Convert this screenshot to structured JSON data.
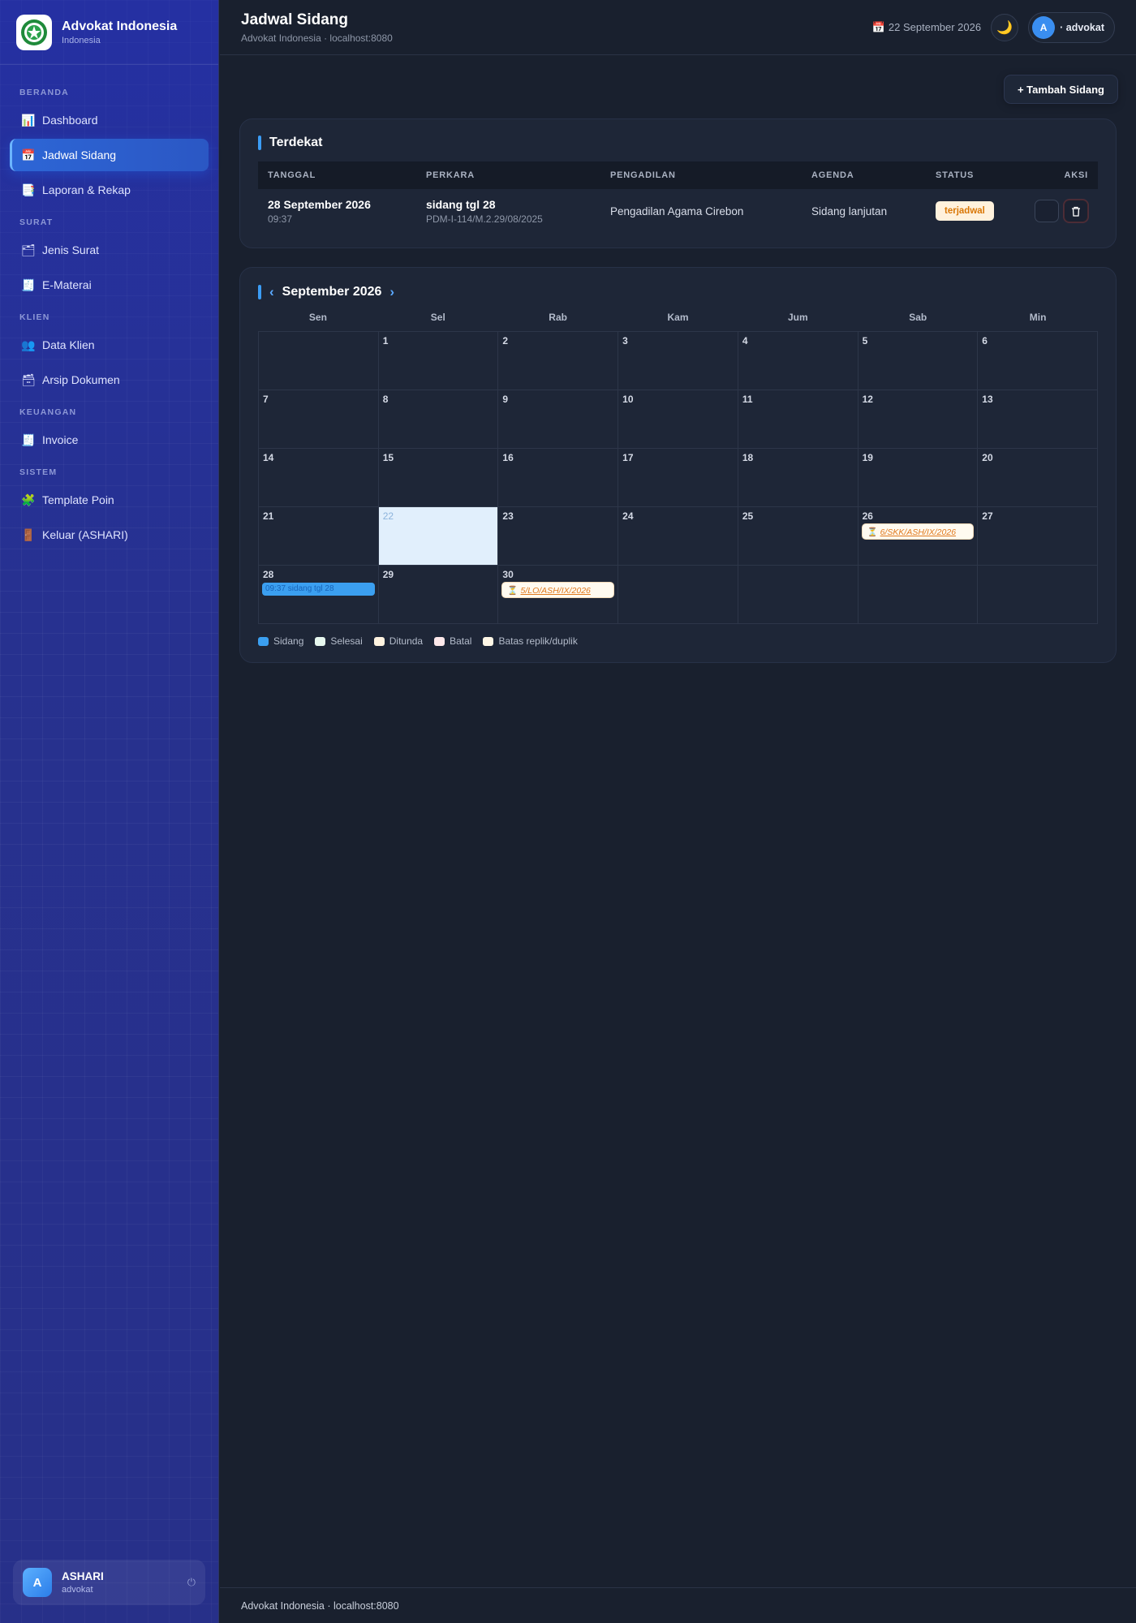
{
  "brand": {
    "title": "Advokat Indonesia",
    "subtitle": "Indonesia"
  },
  "sidebar": {
    "sections": [
      {
        "label": "BERANDA",
        "items": [
          {
            "icon": "📊",
            "label": "Dashboard"
          },
          {
            "icon": "📅",
            "label": "Jadwal Sidang",
            "active": true
          },
          {
            "icon": "📑",
            "label": "Laporan & Rekap"
          }
        ]
      },
      {
        "label": "SURAT",
        "items": [
          {
            "icon": "🗂",
            "label": "Jenis Surat"
          },
          {
            "icon": "🧾",
            "label": "E-Materai"
          }
        ]
      },
      {
        "label": "KLIEN",
        "items": [
          {
            "icon": "👥",
            "label": "Data Klien"
          },
          {
            "icon": "🗃",
            "label": "Arsip Dokumen"
          }
        ]
      },
      {
        "label": "KEUANGAN",
        "items": [
          {
            "icon": "🧾",
            "label": "Invoice"
          }
        ]
      },
      {
        "label": "SISTEM",
        "items": [
          {
            "icon": "🧩",
            "label": "Template Poin"
          },
          {
            "icon": "🚪",
            "label": "Keluar (ASHARI)"
          }
        ]
      }
    ],
    "user": {
      "initial": "A",
      "name": "ASHARI",
      "role": "advokat"
    }
  },
  "header": {
    "title": "Jadwal Sidang",
    "subtitle": "Advokat Indonesia · localhost:8080",
    "date_icon": "📅",
    "date": "22 September 2026",
    "theme_icon": "🌙",
    "user_initial": "A",
    "user_label": "· advokat"
  },
  "actions": {
    "add_label": "+ Tambah Sidang"
  },
  "upcoming": {
    "title": "Terdekat",
    "columns": [
      "TANGGAL",
      "PERKARA",
      "PENGADILAN",
      "AGENDA",
      "STATUS",
      "AKSI"
    ],
    "rows": [
      {
        "date": "28 September 2026",
        "time": "09:37",
        "case": "sidang tgl 28",
        "case_no": "PDM-I-114/M.2.29/08/2025",
        "court": "Pengadilan Agama Cirebon",
        "agenda": "Sidang lanjutan",
        "status": "terjadwal"
      }
    ]
  },
  "calendar": {
    "month_label": "September 2026",
    "prev_icon": "‹",
    "next_icon": "›",
    "weekdays": [
      "Sen",
      "Sel",
      "Rab",
      "Kam",
      "Jum",
      "Sab",
      "Min"
    ],
    "leading_blanks": 1,
    "days_in_month": 30,
    "today": 22,
    "events": [
      {
        "day": 26,
        "type": "batas",
        "label": "6/SKK/ASH/IX/2026"
      },
      {
        "day": 28,
        "type": "sidang",
        "label": "09:37 sidang tgl 28"
      },
      {
        "day": 30,
        "type": "batas",
        "label": "5/LO/ASH/IX/2026"
      }
    ],
    "legend": [
      {
        "label": "Sidang",
        "color": "#3b9ff0"
      },
      {
        "label": "Selesai",
        "color": "#e6f7ee"
      },
      {
        "label": "Ditunda",
        "color": "#fff3e0"
      },
      {
        "label": "Batal",
        "color": "#fde8ea"
      },
      {
        "label": "Batas replik/duplik",
        "color": "#fff7e6"
      }
    ]
  },
  "footer": {
    "text": "Advokat Indonesia · localhost:8080"
  }
}
